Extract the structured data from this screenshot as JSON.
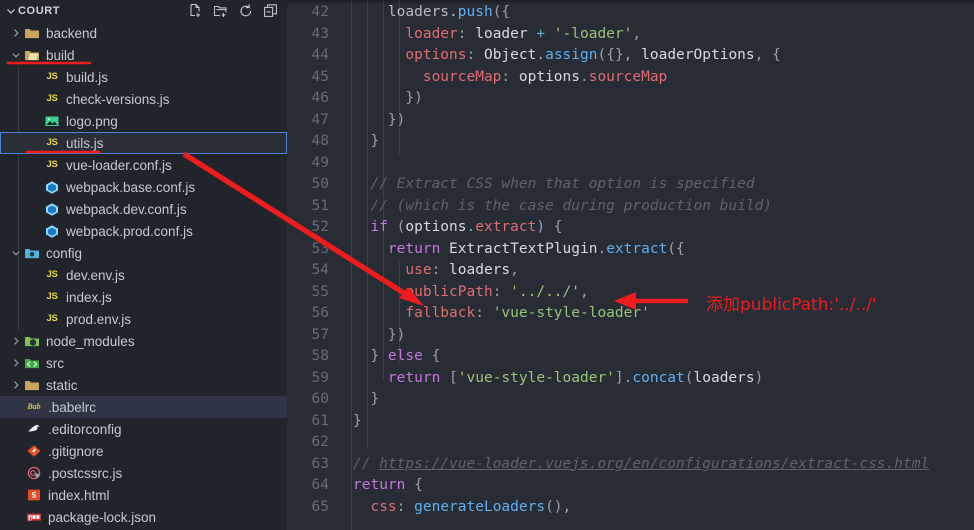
{
  "sidebar": {
    "title": "COURT",
    "collapse_chevron": "⌄",
    "actions": [
      {
        "name": "new-file-icon",
        "label": "New File"
      },
      {
        "name": "new-folder-icon",
        "label": "New Folder"
      },
      {
        "name": "refresh-icon",
        "label": "Refresh Explorer"
      },
      {
        "name": "collapse-all-icon",
        "label": "Collapse Folders in Explorer"
      }
    ],
    "items": [
      {
        "label": "backend",
        "type": "folder",
        "icon": "folder-icon",
        "indent": 1,
        "expanded": false,
        "twisty": "›",
        "state": "none"
      },
      {
        "label": "build",
        "type": "folder",
        "icon": "folder-open-icon",
        "indent": 1,
        "expanded": true,
        "twisty": "⌄",
        "state": "none"
      },
      {
        "label": "build.js",
        "type": "file",
        "icon": "js-icon",
        "indent": 3,
        "state": "none"
      },
      {
        "label": "check-versions.js",
        "type": "file",
        "icon": "js-icon",
        "indent": 3,
        "state": "none"
      },
      {
        "label": "logo.png",
        "type": "file",
        "icon": "image-icon",
        "indent": 3,
        "state": "none"
      },
      {
        "label": "utils.js",
        "type": "file",
        "icon": "js-icon",
        "indent": 3,
        "state": "focused"
      },
      {
        "label": "vue-loader.conf.js",
        "type": "file",
        "icon": "js-icon",
        "indent": 3,
        "state": "none"
      },
      {
        "label": "webpack.base.conf.js",
        "type": "file",
        "icon": "webpack-icon",
        "indent": 3,
        "state": "none"
      },
      {
        "label": "webpack.dev.conf.js",
        "type": "file",
        "icon": "webpack-icon",
        "indent": 3,
        "state": "none"
      },
      {
        "label": "webpack.prod.conf.js",
        "type": "file",
        "icon": "webpack-icon",
        "indent": 3,
        "state": "none"
      },
      {
        "label": "config",
        "type": "folder",
        "icon": "folder-config-icon",
        "indent": 1,
        "expanded": true,
        "twisty": "⌄",
        "state": "none"
      },
      {
        "label": "dev.env.js",
        "type": "file",
        "icon": "js-icon",
        "indent": 3,
        "state": "none"
      },
      {
        "label": "index.js",
        "type": "file",
        "icon": "js-icon",
        "indent": 3,
        "state": "none"
      },
      {
        "label": "prod.env.js",
        "type": "file",
        "icon": "js-icon",
        "indent": 3,
        "state": "none"
      },
      {
        "label": "node_modules",
        "type": "folder",
        "icon": "node-icon",
        "indent": 1,
        "expanded": false,
        "twisty": "›",
        "state": "none"
      },
      {
        "label": "src",
        "type": "folder",
        "icon": "src-icon",
        "indent": 1,
        "expanded": false,
        "twisty": "›",
        "state": "none"
      },
      {
        "label": "static",
        "type": "folder",
        "icon": "folder-icon",
        "indent": 1,
        "expanded": false,
        "twisty": "›",
        "state": "none"
      },
      {
        "label": ".babelrc",
        "type": "file",
        "icon": "babel-icon",
        "indent": 2,
        "state": "selected"
      },
      {
        "label": ".editorconfig",
        "type": "file",
        "icon": "editorconfig-icon",
        "indent": 2,
        "state": "none"
      },
      {
        "label": ".gitignore",
        "type": "file",
        "icon": "git-icon",
        "indent": 2,
        "state": "none"
      },
      {
        "label": ".postcssrc.js",
        "type": "file",
        "icon": "postcss-icon",
        "indent": 2,
        "state": "none"
      },
      {
        "label": "index.html",
        "type": "file",
        "icon": "html5-icon",
        "indent": 2,
        "state": "none"
      },
      {
        "label": "package-lock.json",
        "type": "file",
        "icon": "npm-icon",
        "indent": 2,
        "state": "none"
      }
    ]
  },
  "editor": {
    "first_line_number": 42,
    "lines": [
      {
        "n": 42,
        "tokens": [
          {
            "t": "plain",
            "v": "    loaders."
          },
          {
            "t": "fn",
            "v": "push"
          },
          {
            "t": "punc",
            "v": "({"
          }
        ]
      },
      {
        "n": 43,
        "tokens": [
          {
            "t": "prop",
            "v": "      loader"
          },
          {
            "t": "punc",
            "v": ": "
          },
          {
            "t": "var",
            "v": "loader "
          },
          {
            "t": "op",
            "v": "+"
          },
          {
            "t": "str",
            "v": " '-loader'"
          },
          {
            "t": "punc",
            "v": ","
          }
        ]
      },
      {
        "n": 44,
        "tokens": [
          {
            "t": "prop",
            "v": "      options"
          },
          {
            "t": "punc",
            "v": ": "
          },
          {
            "t": "cls",
            "v": "Object"
          },
          {
            "t": "punc",
            "v": "."
          },
          {
            "t": "fn",
            "v": "assign"
          },
          {
            "t": "punc",
            "v": "({}, "
          },
          {
            "t": "var",
            "v": "loaderOptions"
          },
          {
            "t": "punc",
            "v": ", {"
          }
        ]
      },
      {
        "n": 45,
        "tokens": [
          {
            "t": "prop",
            "v": "        sourceMap"
          },
          {
            "t": "punc",
            "v": ": "
          },
          {
            "t": "var",
            "v": "options"
          },
          {
            "t": "punc",
            "v": "."
          },
          {
            "t": "prop",
            "v": "sourceMap"
          }
        ]
      },
      {
        "n": 46,
        "tokens": [
          {
            "t": "punc",
            "v": "      })"
          }
        ]
      },
      {
        "n": 47,
        "tokens": [
          {
            "t": "punc",
            "v": "    })"
          }
        ]
      },
      {
        "n": 48,
        "tokens": [
          {
            "t": "punc",
            "v": "  }"
          }
        ]
      },
      {
        "n": 49,
        "tokens": []
      },
      {
        "n": 50,
        "tokens": [
          {
            "t": "cmt",
            "v": "  // Extract CSS when that option is specified"
          }
        ]
      },
      {
        "n": 51,
        "tokens": [
          {
            "t": "cmt",
            "v": "  // (which is the case during production build)"
          }
        ]
      },
      {
        "n": 52,
        "tokens": [
          {
            "t": "kw",
            "v": "  if"
          },
          {
            "t": "punc",
            "v": " ("
          },
          {
            "t": "var",
            "v": "options"
          },
          {
            "t": "punc",
            "v": "."
          },
          {
            "t": "prop",
            "v": "extract"
          },
          {
            "t": "punc",
            "v": ") {"
          }
        ]
      },
      {
        "n": 53,
        "tokens": [
          {
            "t": "kw",
            "v": "    return"
          },
          {
            "t": "cls",
            "v": " ExtractTextPlugin"
          },
          {
            "t": "punc",
            "v": "."
          },
          {
            "t": "fn",
            "v": "extract"
          },
          {
            "t": "punc",
            "v": "({"
          }
        ]
      },
      {
        "n": 54,
        "tokens": [
          {
            "t": "prop",
            "v": "      use"
          },
          {
            "t": "punc",
            "v": ": "
          },
          {
            "t": "var",
            "v": "loaders"
          },
          {
            "t": "punc",
            "v": ","
          }
        ]
      },
      {
        "n": 55,
        "tokens": [
          {
            "t": "prop",
            "v": "      publicPath"
          },
          {
            "t": "punc",
            "v": ": "
          },
          {
            "t": "str",
            "v": "'../../'"
          },
          {
            "t": "punc",
            "v": ","
          }
        ]
      },
      {
        "n": 56,
        "tokens": [
          {
            "t": "prop",
            "v": "      fallback"
          },
          {
            "t": "punc",
            "v": ": "
          },
          {
            "t": "str",
            "v": "'vue-style-loader'"
          }
        ]
      },
      {
        "n": 57,
        "tokens": [
          {
            "t": "punc",
            "v": "    })"
          }
        ]
      },
      {
        "n": 58,
        "tokens": [
          {
            "t": "punc",
            "v": "  } "
          },
          {
            "t": "kw",
            "v": "else"
          },
          {
            "t": "punc",
            "v": " {"
          }
        ]
      },
      {
        "n": 59,
        "tokens": [
          {
            "t": "kw",
            "v": "    return"
          },
          {
            "t": "punc",
            "v": " ["
          },
          {
            "t": "str",
            "v": "'vue-style-loader'"
          },
          {
            "t": "punc",
            "v": "]."
          },
          {
            "t": "fn",
            "v": "concat"
          },
          {
            "t": "punc",
            "v": "("
          },
          {
            "t": "var",
            "v": "loaders"
          },
          {
            "t": "punc",
            "v": ")"
          }
        ]
      },
      {
        "n": 60,
        "tokens": [
          {
            "t": "punc",
            "v": "  }"
          }
        ]
      },
      {
        "n": 61,
        "tokens": [
          {
            "t": "punc",
            "v": "}"
          }
        ]
      },
      {
        "n": 62,
        "tokens": []
      },
      {
        "n": 63,
        "tokens": [
          {
            "t": "cmt",
            "v": "// "
          },
          {
            "t": "cmt-url",
            "v": "https://vue-loader.vuejs.org/en/configurations/extract-css.html"
          }
        ]
      },
      {
        "n": 64,
        "tokens": [
          {
            "t": "kw",
            "v": "return"
          },
          {
            "t": "punc",
            "v": " {"
          }
        ]
      },
      {
        "n": 65,
        "tokens": [
          {
            "t": "prop",
            "v": "  css"
          },
          {
            "t": "punc",
            "v": ": "
          },
          {
            "t": "fn",
            "v": "generateLoaders"
          },
          {
            "t": "punc",
            "v": "(),"
          }
        ]
      }
    ]
  },
  "annotations": {
    "color": "#ee1c1c",
    "note_text": "添加publicPath:'../../'",
    "underline_build": "build",
    "underline_utils": "utils.js"
  },
  "colors": {
    "sidebar_bg": "#21242b",
    "editor_bg": "#282c34",
    "selection_bg": "#2f3545",
    "focus_border": "#4d82d6",
    "annotation_red": "#ee1c1c",
    "line_number": "#636b7c"
  }
}
